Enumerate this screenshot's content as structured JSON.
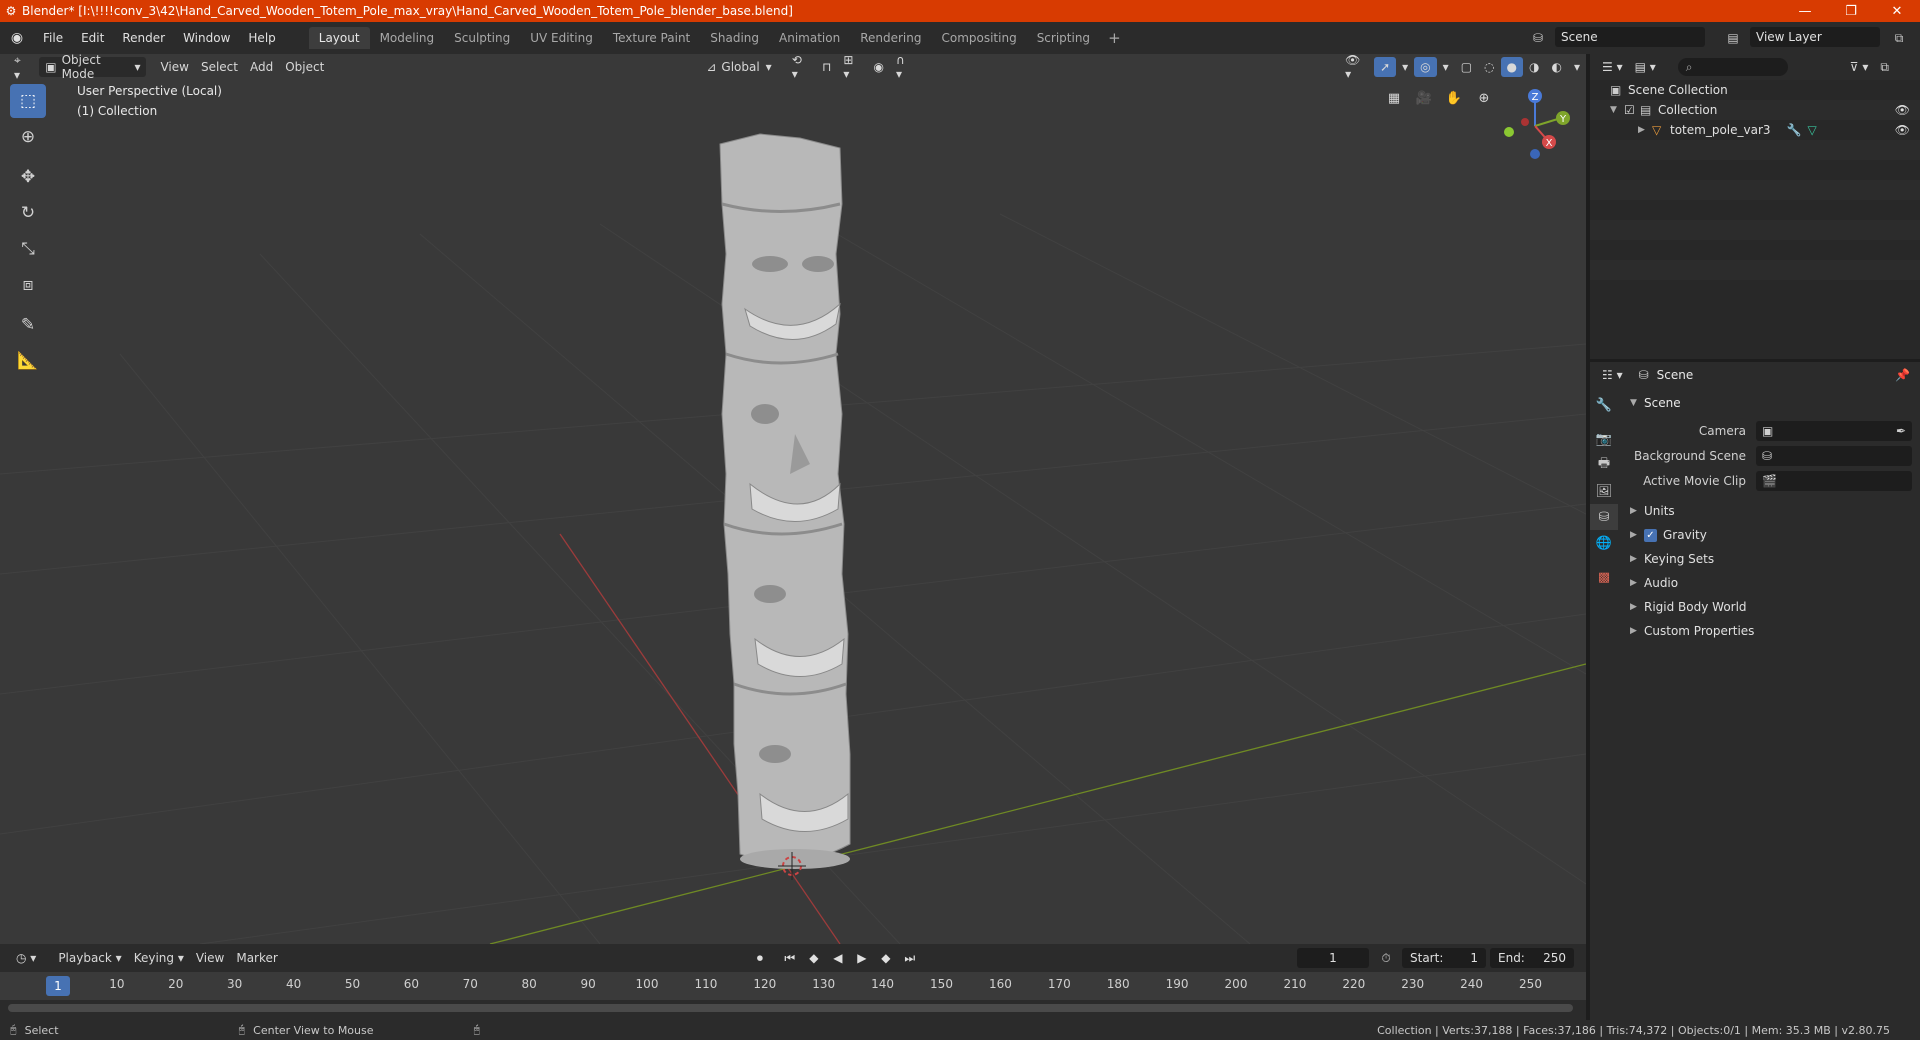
{
  "window": {
    "title": "Blender* [I:\\!!!!conv_3\\42\\Hand_Carved_Wooden_Totem_Pole_max_vray\\Hand_Carved_Wooden_Totem_Pole_blender_base.blend]",
    "minimize": "—",
    "maximize": "❐",
    "close": "✕"
  },
  "menu": [
    "File",
    "Edit",
    "Render",
    "Window",
    "Help"
  ],
  "workspaces": {
    "tabs": [
      "Layout",
      "Modeling",
      "Sculpting",
      "UV Editing",
      "Texture Paint",
      "Shading",
      "Animation",
      "Rendering",
      "Compositing",
      "Scripting"
    ],
    "active": "Layout",
    "add": "+"
  },
  "scene_selector": {
    "value": "Scene"
  },
  "view_layer_selector": {
    "value": "View Layer"
  },
  "viewport": {
    "mode": "Object Mode",
    "menus": [
      "View",
      "Select",
      "Add",
      "Object"
    ],
    "orientation": "Global",
    "info_line1": "User Perspective (Local)",
    "info_line2": "(1) Collection",
    "gizmo": {
      "z": "Z",
      "y": "Y",
      "x": "X"
    }
  },
  "outliner": {
    "search_placeholder": "",
    "rows": [
      {
        "label": "Scene Collection"
      },
      {
        "label": "Collection"
      },
      {
        "label": "totem_pole_var3"
      }
    ]
  },
  "properties": {
    "header_title": "Scene",
    "panel_title": "Scene",
    "fields": [
      {
        "label": "Camera",
        "value": ""
      },
      {
        "label": "Background Scene",
        "value": ""
      },
      {
        "label": "Active Movie Clip",
        "value": ""
      }
    ],
    "subpanels": [
      "Units",
      "Gravity",
      "Keying Sets",
      "Audio",
      "Rigid Body World",
      "Custom Properties"
    ],
    "gravity_checked": true
  },
  "timeline": {
    "menus": [
      "Playback",
      "Keying",
      "View",
      "Marker"
    ],
    "current_frame": "1",
    "start_label": "Start:",
    "start_value": "1",
    "end_label": "End:",
    "end_value": "250",
    "ticks": [
      "1",
      "10",
      "20",
      "30",
      "40",
      "50",
      "60",
      "70",
      "80",
      "90",
      "100",
      "110",
      "120",
      "130",
      "140",
      "150",
      "160",
      "170",
      "180",
      "190",
      "200",
      "210",
      "220",
      "230",
      "240",
      "250"
    ]
  },
  "statusbar": {
    "left_action": "Select",
    "middle_action": "Center View to Mouse",
    "stats": "Collection | Verts:37,188 | Faces:37,186 | Tris:74,372 | Objects:0/1 | Mem: 35.3 MB | v2.80.75"
  },
  "colors": {
    "titlebar": "#d83b01",
    "accent": "#4772b3",
    "viewport_bg": "#393939",
    "x_axis": "#c44a4a",
    "y_axis": "#8aab2c"
  }
}
